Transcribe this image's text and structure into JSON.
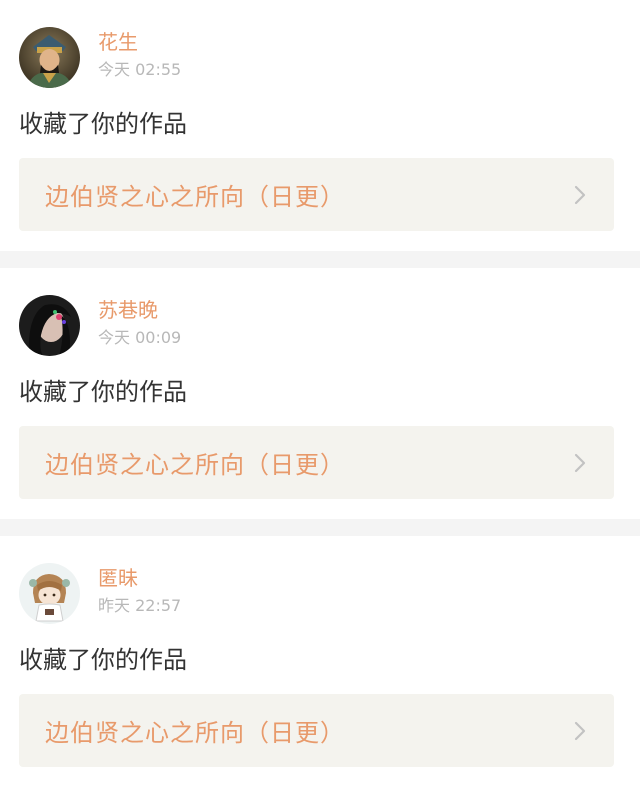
{
  "notifications": [
    {
      "username": "花生",
      "time": "今天 02:55",
      "action": "收藏了你的作品",
      "work_title": "边伯贤之心之所向（日更）",
      "avatar_icon": "avatar-general-portrait"
    },
    {
      "username": "苏巷晚",
      "time": "今天 00:09",
      "action": "收藏了你的作品",
      "work_title": "边伯贤之心之所向（日更）",
      "avatar_icon": "avatar-dark-portrait"
    },
    {
      "username": "匿昧",
      "time": "昨天 22:57",
      "action": "收藏了你的作品",
      "work_title": "边伯贤之心之所向（日更）",
      "avatar_icon": "avatar-cartoon-girl"
    }
  ],
  "colors": {
    "accent": "#e89a6b",
    "link_bg": "#f4f3ee",
    "divider": "#f4f4f4",
    "muted": "#b8b8b8"
  }
}
